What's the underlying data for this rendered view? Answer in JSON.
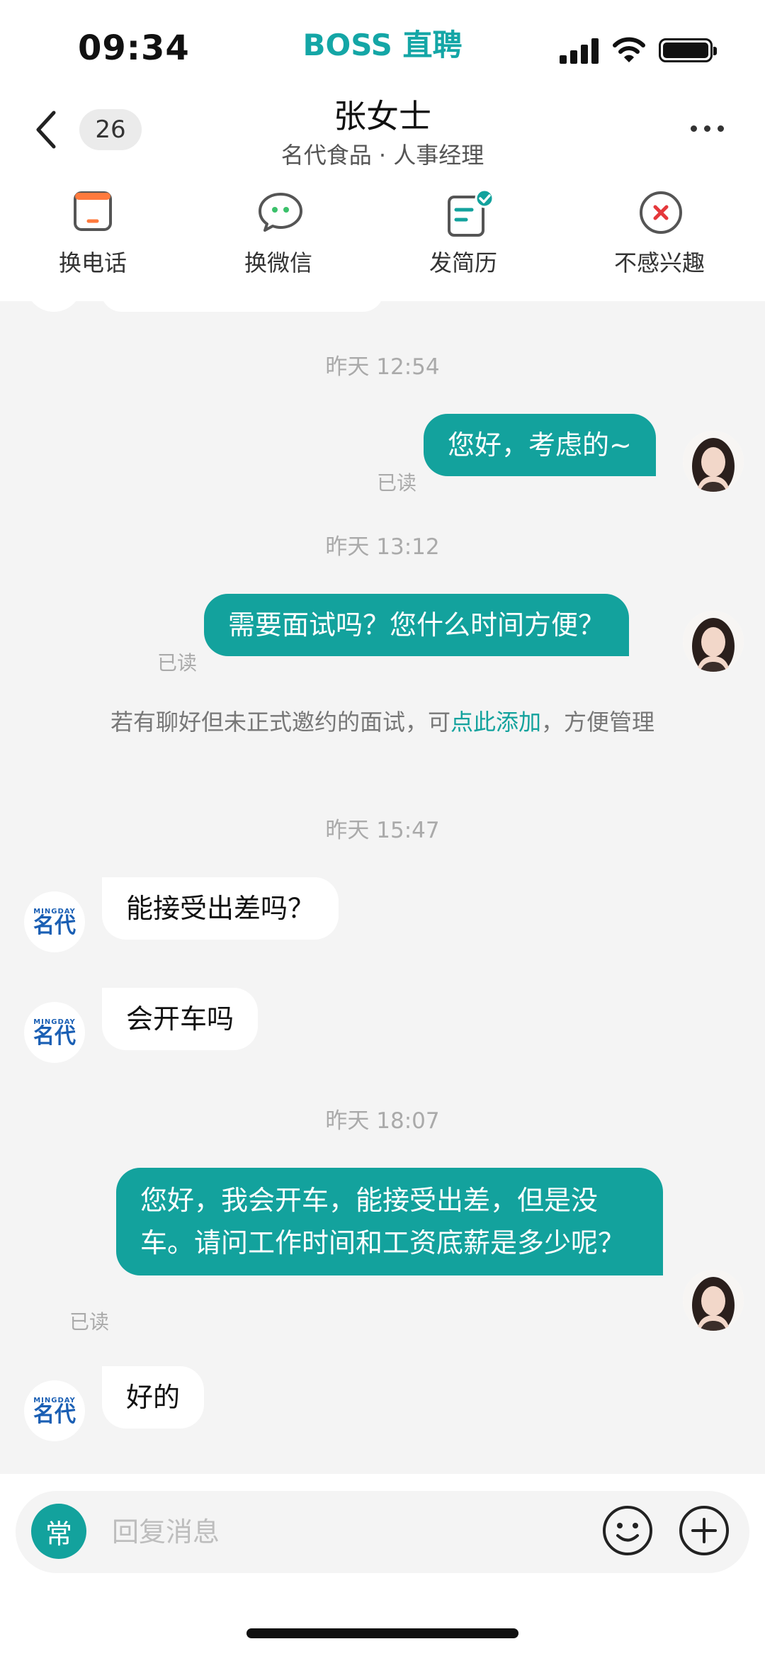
{
  "status_bar": {
    "time": "09:34",
    "app": "BOSS 直聘"
  },
  "nav": {
    "unread_count": "26",
    "contact_name": "张女士",
    "contact_subtitle": "名代食品 · 人事经理"
  },
  "actions": [
    {
      "label": "换电话",
      "icon": "phone-icon"
    },
    {
      "label": "换微信",
      "icon": "wechat-icon"
    },
    {
      "label": "发简历",
      "icon": "resume-icon"
    },
    {
      "label": "不感兴趣",
      "icon": "not-interested-icon"
    }
  ],
  "chat": {
    "ts1": "昨天 12:54",
    "msg1": "您好，考虑的~",
    "msg1_status": "已读",
    "ts2": "昨天 13:12",
    "msg2": "需要面试吗？您什么时间方便？",
    "msg2_status": "已读",
    "system_note_pre": "若有聊好但未正式邀约的面试，可",
    "system_note_link": "点此添加",
    "system_note_post": "，方便管理",
    "ts3": "昨天 15:47",
    "msg3": "能接受出差吗？",
    "msg4": "会开车吗",
    "ts4": "昨天 18:07",
    "msg5": "您好，我会开车，能接受出差，但是没车。请问工作时间和工资底薪是多少呢？",
    "msg5_status": "已读",
    "msg6": "好的",
    "company_logo_en": "MINGDAY",
    "company_logo_cn": "名代"
  },
  "input": {
    "quick_label": "常",
    "placeholder": "回复消息"
  },
  "colors": {
    "accent": "#13a29d",
    "brand": "#14a6a6",
    "danger": "#e5383b"
  }
}
